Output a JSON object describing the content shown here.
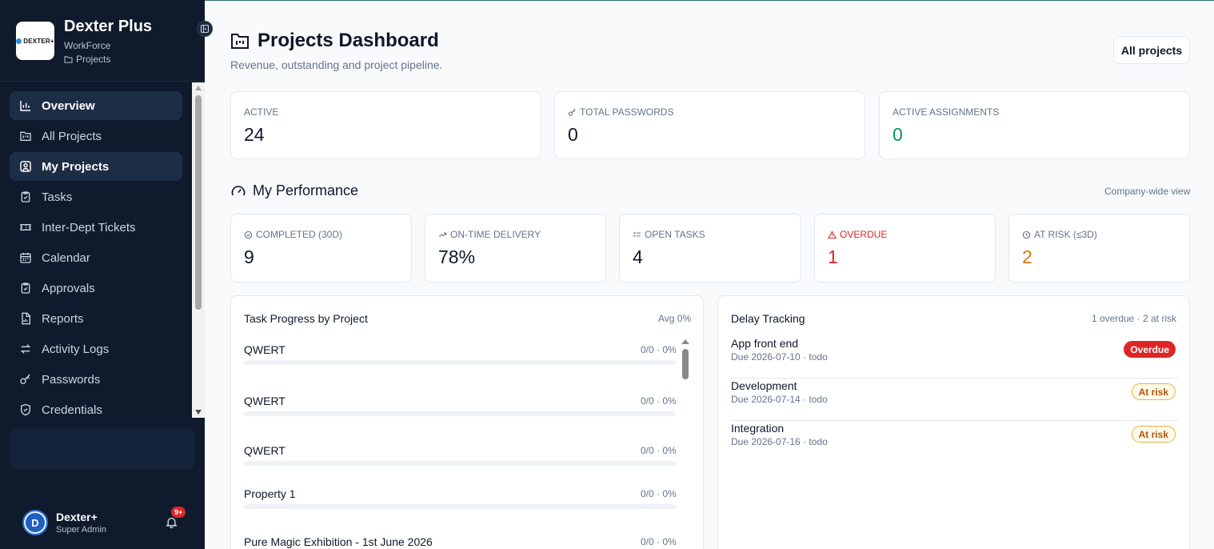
{
  "sidebar": {
    "logo_text": "DEXTER+",
    "brand_title": "Dexter Plus",
    "brand_sub": "WorkForce",
    "brand_crumb": "Projects",
    "items": [
      {
        "label": "Overview",
        "icon": "bar-chart-icon",
        "active": true
      },
      {
        "label": "All Projects",
        "icon": "folder-kanban-icon",
        "active": false
      },
      {
        "label": "My Projects",
        "icon": "user-square-icon",
        "active": true
      },
      {
        "label": "Tasks",
        "icon": "clipboard-check-icon",
        "active": false
      },
      {
        "label": "Inter-Dept Tickets",
        "icon": "ticket-icon",
        "active": false
      },
      {
        "label": "Calendar",
        "icon": "calendar-icon",
        "active": false
      },
      {
        "label": "Approvals",
        "icon": "clipboard-check-icon",
        "active": false
      },
      {
        "label": "Reports",
        "icon": "file-chart-icon",
        "active": false
      },
      {
        "label": "Activity Logs",
        "icon": "arrows-swap-icon",
        "active": false
      },
      {
        "label": "Passwords",
        "icon": "key-icon",
        "active": false
      },
      {
        "label": "Credentials",
        "icon": "shield-icon",
        "active": false
      }
    ],
    "user": {
      "initial": "D",
      "name": "Dexter+",
      "role": "Super Admin"
    },
    "notifications_badge": "9+"
  },
  "header": {
    "title": "Projects Dashboard",
    "subtitle": "Revenue, outstanding and project pipeline.",
    "filter_button": "All projects"
  },
  "stats": {
    "active": {
      "label": "ACTIVE",
      "value": "24"
    },
    "passwords": {
      "label": "TOTAL PASSWORDS",
      "value": "0"
    },
    "assignments": {
      "label": "ACTIVE ASSIGNMENTS",
      "value": "0"
    }
  },
  "performance": {
    "title": "My Performance",
    "scope": "Company-wide view",
    "completed": {
      "label": "COMPLETED (30D)",
      "value": "9"
    },
    "ontime": {
      "label": "ON-TIME DELIVERY",
      "value": "78%"
    },
    "open": {
      "label": "OPEN TASKS",
      "value": "4"
    },
    "overdue": {
      "label": "OVERDUE",
      "value": "1"
    },
    "atrisk": {
      "label": "AT RISK (≤3D)",
      "value": "2"
    }
  },
  "task_progress": {
    "title": "Task Progress by Project",
    "avg": "Avg 0%",
    "projects": [
      {
        "name": "QWERT",
        "meta": "0/0 · 0%",
        "progress": 0
      },
      {
        "name": "QWERT",
        "meta": "0/0 · 0%",
        "progress": 0
      },
      {
        "name": "QWERT",
        "meta": "0/0 · 0%",
        "progress": 0
      },
      {
        "name": "Property 1",
        "meta": "0/0 · 0%",
        "progress": 0
      },
      {
        "name": "Pure Magic Exhibition - 1st June 2026",
        "meta": "0/0 · 0%",
        "progress": 0
      }
    ]
  },
  "delay_tracking": {
    "title": "Delay Tracking",
    "summary": "1 overdue · 2 at risk",
    "items": [
      {
        "name": "App front end",
        "due": "Due 2026-07-10 · todo",
        "status": "Overdue"
      },
      {
        "name": "Development",
        "due": "Due 2026-07-14 · todo",
        "status": "At risk"
      },
      {
        "name": "Integration",
        "due": "Due 2026-07-16 · todo",
        "status": "At risk"
      }
    ]
  },
  "colors": {
    "sidebar_bg": "#0f1b2d",
    "accent_green": "#059669",
    "danger": "#dc2626",
    "warning": "#d97706"
  }
}
